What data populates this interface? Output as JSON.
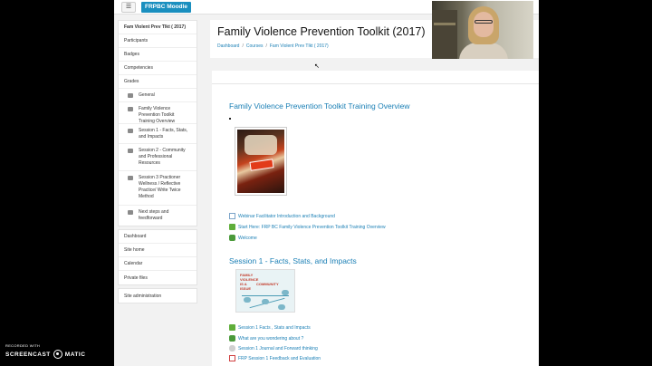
{
  "topbar": {
    "menu_icon": "hamburger-icon",
    "brand": "FRPBC Moodle"
  },
  "sidebar": {
    "course_nav": [
      {
        "label": "Fam Violent Prev Tlkt ( 2017)",
        "bold": true
      },
      {
        "label": "Participants"
      },
      {
        "label": "Badges"
      },
      {
        "label": "Competencies"
      },
      {
        "label": "Grades"
      }
    ],
    "sections": [
      {
        "label": "General",
        "icon": "folder-icon"
      },
      {
        "label": "Family Violence Prevention Toolkit Training Overview",
        "icon": "folder-icon"
      },
      {
        "label": "Session 1 - Facts, Stats, and Impacts",
        "icon": "folder-icon"
      },
      {
        "label": "Session 2 - Community and Professional Resources",
        "icon": "folder-icon"
      },
      {
        "label": "Session 3 Practioner Wellness / Reflective Practice/ Write Twice Method",
        "icon": "folder-icon"
      },
      {
        "label": "Next steps and feedforward",
        "icon": "folder-icon"
      }
    ],
    "site_nav": [
      {
        "label": "Dashboard"
      },
      {
        "label": "Site home"
      },
      {
        "label": "Calendar"
      },
      {
        "label": "Private files"
      }
    ],
    "admin": {
      "label": "Site administration"
    }
  },
  "header": {
    "title": "Family Violence Prevention Toolkit (2017)",
    "breadcrumb": [
      "Dashboard",
      "Courses",
      "Fam Violent Prev Tlkt ( 2017)"
    ],
    "separator": "/"
  },
  "content": {
    "section1": {
      "title": "Family Violence Prevention Toolkit Training Overview",
      "resources": [
        {
          "label": "Webinar Facilitator Introduction and Background",
          "icon": "page-icon"
        },
        {
          "label": "Start Here: FRP BC Family Violence Prevention Toolkit Training Overview",
          "icon": "green-book-icon"
        },
        {
          "label": "Welcome",
          "icon": "forum-icon"
        }
      ]
    },
    "section2": {
      "title": "Session 1 - Facts, Stats, and Impacts",
      "image_text": [
        "FAMILY",
        "VIOLENCE",
        "IS A",
        "COMMUNITY",
        "ISSUE"
      ],
      "resources": [
        {
          "label": "Session 1 Facts , Stats and Impacts",
          "icon": "green-book-icon"
        },
        {
          "label": "What are you wondering about ?",
          "icon": "forum-icon"
        },
        {
          "label": "Session 1 Journal and Forward thinking",
          "icon": "journal-icon"
        },
        {
          "label": "FRP Session 1 Feedback and Evaluation",
          "icon": "pdf-icon"
        }
      ]
    }
  },
  "screencast": {
    "recorded_with": "RECORDED WITH",
    "brand_left": "SCREENCAST",
    "brand_right": "MATIC"
  }
}
